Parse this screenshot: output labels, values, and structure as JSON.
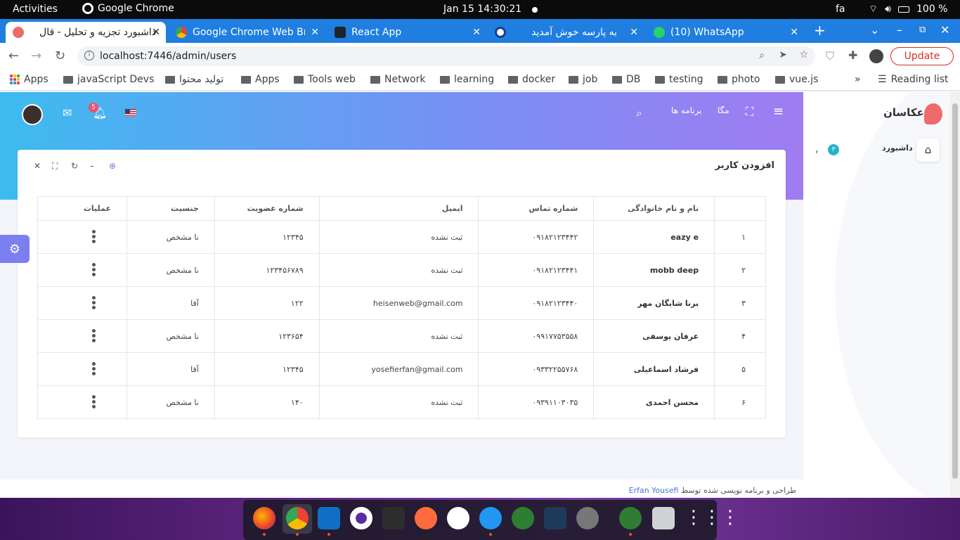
{
  "topbar": {
    "activities": "Activities",
    "app_name": "Google Chrome",
    "clock": "Jan 15  14:30:21",
    "lang": "fa",
    "battery": "100 %"
  },
  "tabs": [
    {
      "label": "داشبورد تجزیه و تحلیل - قال",
      "active": true
    },
    {
      "label": "Google Chrome Web Bro"
    },
    {
      "label": "React App"
    },
    {
      "label": "به پارسه خوش آمدید"
    },
    {
      "label": "(10) WhatsApp"
    }
  ],
  "address": {
    "url": "localhost:7446/admin/users",
    "update_label": "Update"
  },
  "bookmarks": [
    "Apps",
    "javaScript Devs",
    "تولید محتوا",
    "Apps",
    "Tools web",
    "Network",
    "learning",
    "docker",
    "job",
    "DB",
    "testing",
    "photo",
    "vue.js"
  ],
  "reading_list": "Reading list",
  "header": {
    "notif_count": "5",
    "programs": "برنامه ها",
    "mega": "مگا"
  },
  "sidebar": {
    "brand": "عکاسان",
    "dashboard": "داشبورد",
    "badge": "۳"
  },
  "card": {
    "title": "افزودن کاربر",
    "columns": [
      "",
      "نام و نام خانوادگی",
      "شماره تماس",
      "ایمیل",
      "شماره عضویت",
      "جنسیت",
      "عملیات"
    ],
    "rows": [
      {
        "idx": "۱",
        "name": "eazy e",
        "phone": "۰۹۱۸۲۱۲۳۴۴۲",
        "email": "ثبت نشده",
        "member": "۱۲۳۴۵",
        "gender": "نا مشخص"
      },
      {
        "idx": "۲",
        "name": "mobb deep",
        "phone": "۰۹۱۸۲۱۲۳۴۴۱",
        "email": "ثبت نشده",
        "member": "۱۲۳۴۵۶۷۸۹",
        "gender": "نا مشخص"
      },
      {
        "idx": "۳",
        "name": "برنا شایگان مهر",
        "phone": "۰۹۱۸۲۱۲۳۴۴۰",
        "email": "heisenweb@gmail.com",
        "member": "۱۲۲",
        "gender": "آقا"
      },
      {
        "idx": "۴",
        "name": "عرفان یوسفی",
        "phone": "۰۹۹۱۷۷۵۳۵۵۸",
        "email": "ثبت نشده",
        "member": "۱۲۳۶۵۴",
        "gender": "نا مشخص"
      },
      {
        "idx": "۵",
        "name": "فرشاد اسماعیلی",
        "phone": "۰۹۳۳۲۲۵۵۷۶۸",
        "email": "yosefierfan@gmail.com",
        "member": "۱۲۳۴۵",
        "gender": "آقا"
      },
      {
        "idx": "۶",
        "name": "محسن احمدی",
        "phone": "۰۹۳۹۱۱۰۳۰۳۵",
        "email": "ثبت نشده",
        "member": "۱۴۰",
        "gender": "نا مشخص"
      }
    ]
  },
  "footer": {
    "text": "طراحی و برنامه نویسی شده توسط",
    "author": "Erfan Yousefi"
  },
  "colors": {
    "accent": "#7a8ef3",
    "chrome_blue": "#1f7ee0",
    "update_red": "#d93025"
  }
}
